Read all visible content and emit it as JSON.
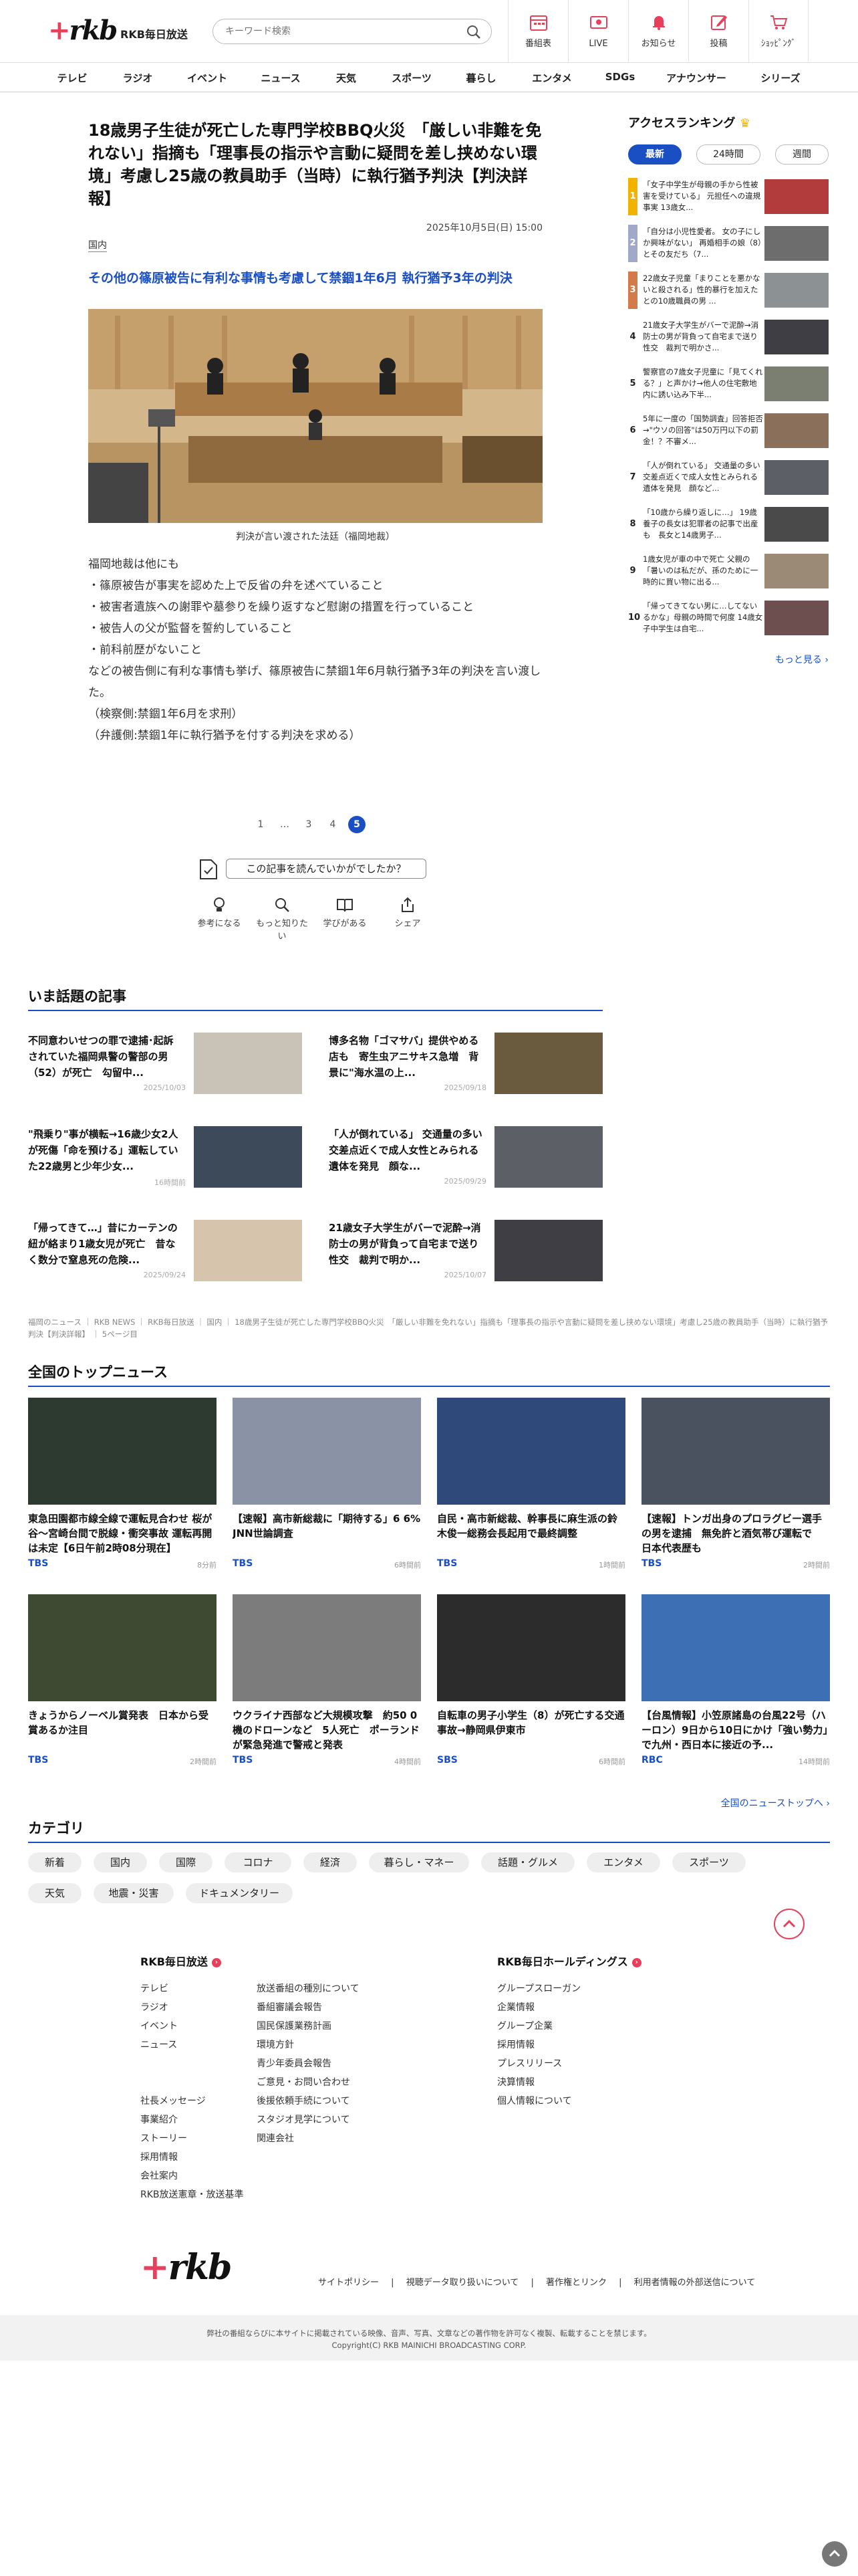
{
  "header": {
    "brand": "RKB毎日放送",
    "search_placeholder": "キーワード検索",
    "buttons": [
      {
        "label": "番組表",
        "icon": "calendar-icon"
      },
      {
        "label": "LIVE",
        "icon": "live-tv-icon"
      },
      {
        "label": "お知らせ",
        "icon": "bell-icon"
      },
      {
        "label": "投稿",
        "icon": "pencil-icon"
      },
      {
        "label": "ｼｮｯﾋﾟﾝｸﾞ",
        "icon": "cart-icon"
      }
    ]
  },
  "nav": [
    "テレビ",
    "ラジオ",
    "イベント",
    "ニュース",
    "天気",
    "スポーツ",
    "暮らし",
    "エンタメ",
    "SDGs",
    "アナウンサー",
    "シリーズ"
  ],
  "article": {
    "title": "18歳男子生徒が死亡した専門学校BBQ火災　「厳しい非難を免れない」指摘も「理事長の指示や言動に疑問を差し挟めない環境」考慮し25歳の教員助手（当時）に執行猶予判決【判決詳報】",
    "date": "2025年10月5日(日) 15:00",
    "category": "国内",
    "headline": "その他の篠原被告に有利な事情も考慮して禁錮1年6月 執行猶予3年の判決",
    "photo_caption": "判決が言い渡された法廷（福岡地裁）",
    "body": [
      "福岡地裁は他にも",
      "・篠原被告が事実を認めた上で反省の弁を述べていること",
      "・被害者遺族への謝罪や墓参りを繰り返すなど慰謝の措置を行っていること",
      "・被告人の父が監督を誓約していること",
      "・前科前歴がないこと",
      "などの被告側に有利な事情も挙げ、篠原被告に禁錮1年6月執行猶予3年の判決を言い渡した。",
      "（検察側:禁錮1年6月を求刑）",
      "（弁護側:禁錮1年に執行猶予を付する判決を求める）"
    ],
    "pager": [
      "1",
      "…",
      "3",
      "4",
      "5"
    ],
    "pager_current": "5",
    "survey_question": "この記事を読んでいかがでしたか？",
    "reactions": [
      {
        "label": "参考になる",
        "icon": "bulb-icon"
      },
      {
        "label": "もっと知りたい",
        "icon": "magnifier-icon"
      },
      {
        "label": "学びがある",
        "icon": "book-icon"
      },
      {
        "label": "シェア",
        "icon": "share-icon"
      }
    ]
  },
  "ranking": {
    "title": "アクセスランキング",
    "tabs": [
      "最新",
      "24時間",
      "週間"
    ],
    "items": [
      {
        "rank": "1",
        "text": "「女子中学生が母親の手から性被害を受けている」 元担任への違規事実 13歳女..."
      },
      {
        "rank": "2",
        "text": "「自分は小児性愛者。 女の子にしか興味がない」 再婚相手の娘（8）とその友だち（7..."
      },
      {
        "rank": "3",
        "text": "22歳女子児童「まりことを悪かないと殺される」性的暴行を加えたとの10歳職員の男 ..."
      },
      {
        "rank": "4",
        "text": "21歳女子大学生がバーで泥酔→消防士の男が背負って自宅まで送り性交　裁判で明かさ..."
      },
      {
        "rank": "5",
        "text": "警察官の7歳女子児童に「見てくれる？」と声かけ→他人の住宅敷地内に誘い込み下半..."
      },
      {
        "rank": "6",
        "text": "5年に一度の「国勢調査」回答拒否→\"ウソの回答\"は50万円以下の罰金！？不審メ..."
      },
      {
        "rank": "7",
        "text": "「人が倒れている」 交通量の多い交差点近くで成人女性とみられる遺体を発見　顔など..."
      },
      {
        "rank": "8",
        "text": "「10歳から繰り返しに…」 19歳養子の長女は犯罪者の記事で出産も　長女と14歳男子..."
      },
      {
        "rank": "9",
        "text": "1歳女児が車の中で死亡 父親の「暑いのは私だが、孫のために一時的に買い物に出る..."
      },
      {
        "rank": "10",
        "text": "「帰ってきてない男に…してないるかな」母親の時間で何度 14歳女子中学生は自宅..."
      }
    ],
    "more": "もっと見る"
  },
  "topics": {
    "title": "いま話題の記事",
    "items": [
      {
        "title": "不同意わいせつの罪で逮捕･起訴されていた福岡県警の警部の男（52）が死亡　勾留中...",
        "date": "2025/10/03"
      },
      {
        "title": "博多名物「ゴマサバ」提供やめる店も　寄生虫アニサキス急増　背景に\"海水温の上...",
        "date": "2025/09/18"
      },
      {
        "title": "\"飛乗り\"事が横転→16歳少女2人が死傷「命を預ける」運転していた22歳男と少年少女...",
        "date": "16時間前"
      },
      {
        "title": "「人が倒れている」 交通量の多い交差点近くで成人女性とみられる遺体を発見　顔な...",
        "date": "2025/09/29"
      },
      {
        "title": "「帰ってきて…」昔にカーテンの紐が絡まり1歳女児が死亡　昔なく数分で窒息死の危険...",
        "date": "2025/09/24"
      },
      {
        "title": "21歳女子大学生がバーで泥酔→消防士の男が背負って自宅まで送り性交　裁判で明か...",
        "date": "2025/10/07"
      }
    ]
  },
  "breadcrumb": "福岡のニュース ｜ RKB NEWS ｜ RKB毎日放送 ｜ 国内 ｜ 18歳男子生徒が死亡した専門学校BBQ火災　「厳しい非難を免れない」指摘も「理事長の指示や言動に疑問を差し挟めない環境」考慮し25歳の教員助手（当時）に執行猶予判決【判決詳報】 ｜ 5ページ目",
  "top_news": {
    "title": "全国のトップニュース",
    "items": [
      {
        "title": "東急田園都市線全線で運転見合わせ 桜が谷〜宮崎台間で脱線・衝突事故 運転再開は未定【6日午前2時08分現在】",
        "source": "TBS",
        "age": "8分前"
      },
      {
        "title": "【速報】高市新総裁に「期待する」6 6%　JNN世論調査",
        "source": "TBS",
        "age": "6時間前"
      },
      {
        "title": "自民・高市新総裁、幹事長に麻生派の鈴木俊一総務会長起用で最終調整",
        "source": "TBS",
        "age": "1時間前"
      },
      {
        "title": "【速報】トンガ出身のプロラグビー選手の男を逮捕　無免許と酒気帯び運転で　日本代表歴も",
        "source": "TBS",
        "age": "2時間前"
      },
      {
        "title": "きょうからノーベル賞発表　日本から受賞あるか注目",
        "source": "TBS",
        "age": "2時間前"
      },
      {
        "title": "ウクライナ西部など大規模攻撃　約50 0機のドローンなど　5人死亡　ポーランドが緊急発進で警戒と発表",
        "source": "TBS",
        "age": "4時間前"
      },
      {
        "title": "自転車の男子小学生（8）が死亡する交通事故→静岡県伊東市",
        "source": "SBS",
        "age": "6時間前"
      },
      {
        "title": "【台風情報】小笠原諸島の台風22号（ハーロン）9日から10日にかけ「強い勢力」で九州・西日本に接近の予...",
        "source": "RBC",
        "age": "14時間前"
      }
    ],
    "more": "全国のニューストップへ"
  },
  "categories": {
    "title": "カテゴリ",
    "items": [
      "新着",
      "国内",
      "国際",
      "コロナ",
      "経済",
      "暮らし・マネー",
      "話題・グルメ",
      "エンタメ",
      "スポーツ",
      "天気",
      "地震・災害",
      "ドキュメンタリー"
    ]
  },
  "footer": {
    "col1_title": "RKB毎日放送",
    "col1a": [
      "テレビ",
      "ラジオ",
      "イベント",
      "ニュース"
    ],
    "col1b": [
      "放送番組の種別について",
      "番組審議会報告",
      "国民保護業務計画",
      "環境方針",
      "青少年委員会報告",
      "ご意見・お問い合わせ",
      "後援依頼手続について",
      "スタジオ見学について",
      "関連会社"
    ],
    "col1c": [
      "社長メッセージ",
      "事業紹介",
      "ストーリー",
      "採用情報",
      "会社案内",
      "RKB放送憲章・放送基準"
    ],
    "col2_title": "RKB毎日ホールディングス",
    "col2": [
      "グループスローガン",
      "企業情報",
      "グループ企業",
      "採用情報",
      "プレスリリース",
      "決算情報",
      "個人情報について"
    ],
    "links": [
      "サイトポリシー",
      "視聴データ取り扱いについて",
      "著作権とリンク",
      "利用者情報の外部送信について"
    ],
    "copy1": "弊社の番組ならびに本サイトに掲載されている映像、音声、写真、文章などの著作物を許可なく複製、転載することを禁じます。",
    "copy2": "Copyright(C) RKB MAINICHI BROADCASTING CORP."
  },
  "colors": {
    "accent": "#1a4fc4",
    "brand": "#e8405a"
  }
}
